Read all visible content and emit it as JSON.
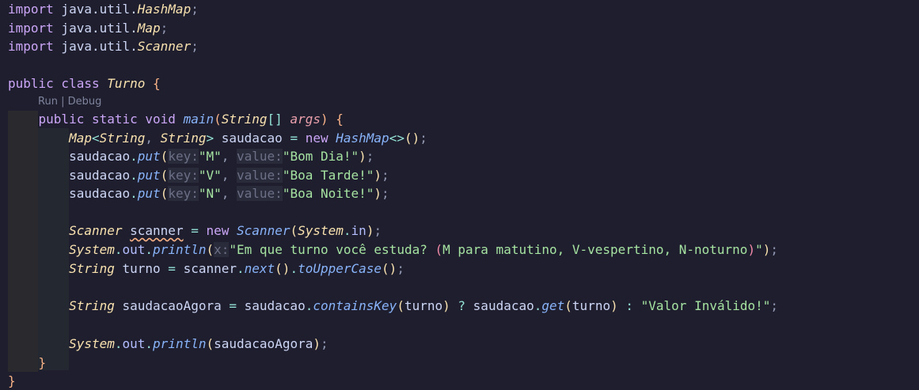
{
  "codelens": {
    "run": "Run",
    "sep": " | ",
    "debug": "Debug"
  },
  "lines": [
    [
      {
        "t": "import",
        "c": "kw"
      },
      {
        "t": " java.util.",
        "c": "var"
      },
      {
        "t": "HashMap",
        "c": "type"
      },
      {
        "t": ";",
        "c": "punc"
      }
    ],
    [
      {
        "t": "import",
        "c": "kw"
      },
      {
        "t": " java.util.",
        "c": "var"
      },
      {
        "t": "Map",
        "c": "type"
      },
      {
        "t": ";",
        "c": "punc"
      }
    ],
    [
      {
        "t": "import",
        "c": "kw"
      },
      {
        "t": " java.util.",
        "c": "var"
      },
      {
        "t": "Scanner",
        "c": "type"
      },
      {
        "t": ";",
        "c": "punc"
      }
    ],
    [],
    [
      {
        "t": "public class ",
        "c": "kw"
      },
      {
        "t": "Turno",
        "c": "type"
      },
      {
        "t": " {",
        "c": "brace"
      }
    ],
    [
      {
        "t": "    public static void ",
        "c": "kw"
      },
      {
        "t": "main",
        "c": "fn"
      },
      {
        "t": "(",
        "c": "brace"
      },
      {
        "t": "String",
        "c": "type"
      },
      {
        "t": "[]",
        "c": "op"
      },
      {
        "t": " ",
        "c": "var"
      },
      {
        "t": "args",
        "c": "param"
      },
      {
        "t": ")",
        "c": "brace"
      },
      {
        "t": " {",
        "c": "brace"
      }
    ],
    [
      {
        "t": "        ",
        "c": "var"
      },
      {
        "t": "Map",
        "c": "type"
      },
      {
        "t": "<",
        "c": "op"
      },
      {
        "t": "String",
        "c": "type"
      },
      {
        "t": ", ",
        "c": "punc"
      },
      {
        "t": "String",
        "c": "type"
      },
      {
        "t": ">",
        "c": "op"
      },
      {
        "t": " saudacao ",
        "c": "var"
      },
      {
        "t": "=",
        "c": "op"
      },
      {
        "t": " new ",
        "c": "kw"
      },
      {
        "t": "HashMap",
        "c": "fn"
      },
      {
        "t": "<>",
        "c": "op"
      },
      {
        "t": "()",
        "c": "paren"
      },
      {
        "t": ";",
        "c": "punc"
      }
    ],
    [
      {
        "t": "        saudacao",
        "c": "var"
      },
      {
        "t": ".",
        "c": "op"
      },
      {
        "t": "put",
        "c": "fn"
      },
      {
        "t": "(",
        "c": "paren"
      },
      {
        "t": "key:",
        "c": "hint"
      },
      {
        "t": "\"M\"",
        "c": "str"
      },
      {
        "t": ", ",
        "c": "punc"
      },
      {
        "t": "value:",
        "c": "hint"
      },
      {
        "t": "\"Bom Dia!\"",
        "c": "str"
      },
      {
        "t": ")",
        "c": "paren"
      },
      {
        "t": ";",
        "c": "punc"
      }
    ],
    [
      {
        "t": "        saudacao",
        "c": "var"
      },
      {
        "t": ".",
        "c": "op"
      },
      {
        "t": "put",
        "c": "fn"
      },
      {
        "t": "(",
        "c": "paren"
      },
      {
        "t": "key:",
        "c": "hint"
      },
      {
        "t": "\"V\"",
        "c": "str"
      },
      {
        "t": ", ",
        "c": "punc"
      },
      {
        "t": "value:",
        "c": "hint"
      },
      {
        "t": "\"Boa Tarde!\"",
        "c": "str"
      },
      {
        "t": ")",
        "c": "paren"
      },
      {
        "t": ";",
        "c": "punc"
      }
    ],
    [
      {
        "t": "        saudacao",
        "c": "var"
      },
      {
        "t": ".",
        "c": "op"
      },
      {
        "t": "put",
        "c": "fn"
      },
      {
        "t": "(",
        "c": "paren"
      },
      {
        "t": "key:",
        "c": "hint"
      },
      {
        "t": "\"N\"",
        "c": "str"
      },
      {
        "t": ", ",
        "c": "punc"
      },
      {
        "t": "value:",
        "c": "hint"
      },
      {
        "t": "\"Boa Noite!\"",
        "c": "str"
      },
      {
        "t": ")",
        "c": "paren"
      },
      {
        "t": ";",
        "c": "punc"
      }
    ],
    [],
    [
      {
        "t": "        ",
        "c": "var"
      },
      {
        "t": "Scanner",
        "c": "type"
      },
      {
        "t": " ",
        "c": "var"
      },
      {
        "t": "scanner",
        "c": "warn"
      },
      {
        "t": " ",
        "c": "var"
      },
      {
        "t": "=",
        "c": "op"
      },
      {
        "t": " new ",
        "c": "kw"
      },
      {
        "t": "Scanner",
        "c": "fn"
      },
      {
        "t": "(",
        "c": "paren"
      },
      {
        "t": "System",
        "c": "type"
      },
      {
        "t": ".",
        "c": "op"
      },
      {
        "t": "in",
        "c": "prop"
      },
      {
        "t": ")",
        "c": "paren"
      },
      {
        "t": ";",
        "c": "punc"
      }
    ],
    [
      {
        "t": "        ",
        "c": "var"
      },
      {
        "t": "System",
        "c": "type"
      },
      {
        "t": ".",
        "c": "op"
      },
      {
        "t": "out",
        "c": "prop"
      },
      {
        "t": ".",
        "c": "op"
      },
      {
        "t": "println",
        "c": "fn"
      },
      {
        "t": "(",
        "c": "paren"
      },
      {
        "t": "x:",
        "c": "hint"
      },
      {
        "t": "\"Em que turno você estuda? ",
        "c": "str"
      },
      {
        "t": "(",
        "c": "pstr"
      },
      {
        "t": "M para matutino, V-vespertino, N-noturno",
        "c": "str"
      },
      {
        "t": ")",
        "c": "pstr"
      },
      {
        "t": "\"",
        "c": "str"
      },
      {
        "t": ")",
        "c": "paren"
      },
      {
        "t": ";",
        "c": "punc"
      }
    ],
    [
      {
        "t": "        ",
        "c": "var"
      },
      {
        "t": "String",
        "c": "type"
      },
      {
        "t": " turno ",
        "c": "var"
      },
      {
        "t": "=",
        "c": "op"
      },
      {
        "t": " scanner",
        "c": "var"
      },
      {
        "t": ".",
        "c": "op"
      },
      {
        "t": "next",
        "c": "fn"
      },
      {
        "t": "()",
        "c": "paren"
      },
      {
        "t": ".",
        "c": "op"
      },
      {
        "t": "toUpperCase",
        "c": "fn"
      },
      {
        "t": "()",
        "c": "paren"
      },
      {
        "t": ";",
        "c": "punc"
      }
    ],
    [],
    [
      {
        "t": "        ",
        "c": "var"
      },
      {
        "t": "String",
        "c": "type"
      },
      {
        "t": " saudacaoAgora ",
        "c": "var"
      },
      {
        "t": "=",
        "c": "op"
      },
      {
        "t": " saudacao",
        "c": "var"
      },
      {
        "t": ".",
        "c": "op"
      },
      {
        "t": "containsKey",
        "c": "fn"
      },
      {
        "t": "(",
        "c": "paren"
      },
      {
        "t": "turno",
        "c": "var"
      },
      {
        "t": ")",
        "c": "paren"
      },
      {
        "t": " ? ",
        "c": "op"
      },
      {
        "t": "saudacao",
        "c": "var"
      },
      {
        "t": ".",
        "c": "op"
      },
      {
        "t": "get",
        "c": "fn"
      },
      {
        "t": "(",
        "c": "paren"
      },
      {
        "t": "turno",
        "c": "var"
      },
      {
        "t": ")",
        "c": "paren"
      },
      {
        "t": " : ",
        "c": "op"
      },
      {
        "t": "\"Valor Inválido!\"",
        "c": "str"
      },
      {
        "t": ";",
        "c": "punc"
      }
    ],
    [],
    [
      {
        "t": "        ",
        "c": "var"
      },
      {
        "t": "System",
        "c": "type"
      },
      {
        "t": ".",
        "c": "op"
      },
      {
        "t": "out",
        "c": "prop"
      },
      {
        "t": ".",
        "c": "op"
      },
      {
        "t": "println",
        "c": "fn"
      },
      {
        "t": "(",
        "c": "paren"
      },
      {
        "t": "saudacaoAgora",
        "c": "var"
      },
      {
        "t": ")",
        "c": "paren"
      },
      {
        "t": ";",
        "c": "punc"
      }
    ],
    [
      {
        "t": "    }",
        "c": "brace"
      }
    ],
    [
      {
        "t": "}",
        "c": "brace"
      }
    ]
  ]
}
